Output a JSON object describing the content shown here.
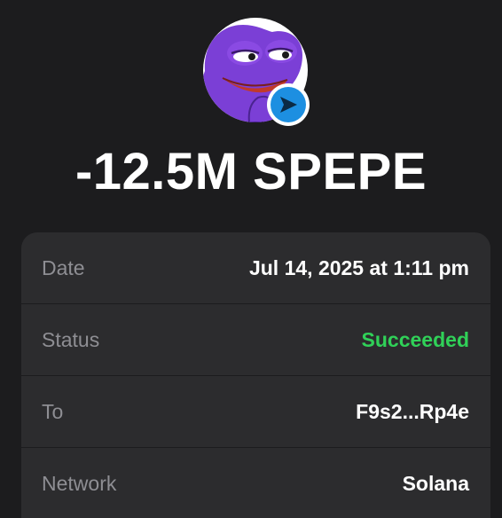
{
  "token": {
    "icon": "pepe-frog-avatar",
    "badge_icon": "send-arrow-icon",
    "badge_color": "#1d8fe1",
    "amount_text": "-12.5M SPEPE"
  },
  "details": [
    {
      "label": "Date",
      "value": "Jul 14, 2025 at 1:11 pm"
    },
    {
      "label": "Status",
      "value": "Succeeded",
      "value_color": "#30d158"
    },
    {
      "label": "To",
      "value": "F9s2...Rp4e"
    },
    {
      "label": "Network",
      "value": "Solana"
    }
  ],
  "colors": {
    "background": "#1c1c1e",
    "card": "#2c2c2e",
    "label": "#8e8e93",
    "success": "#30d158"
  }
}
